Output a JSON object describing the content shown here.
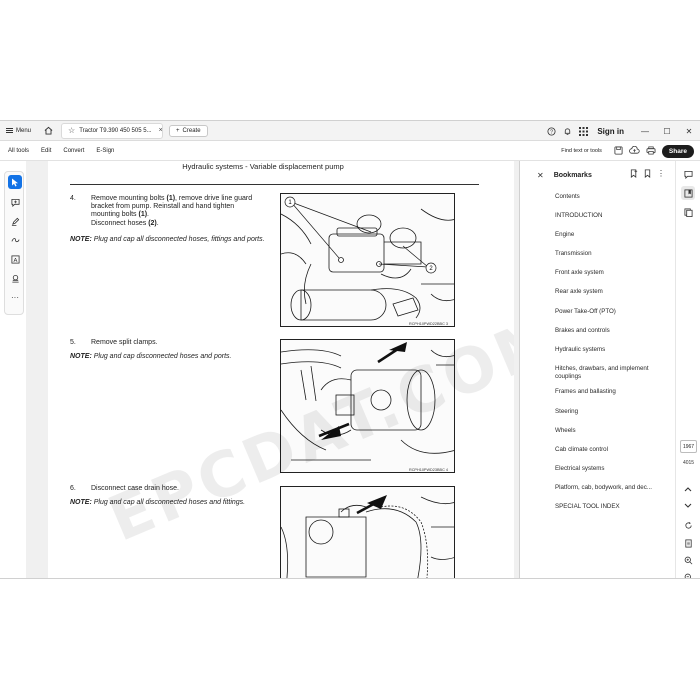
{
  "titlebar": {
    "menu_label": "Menu",
    "tab_title": "Tractor T9.390 450 505 5...",
    "create_label": "Create",
    "signin_label": "Sign in"
  },
  "toolbar": {
    "items": [
      "All tools",
      "Edit",
      "Convert",
      "E-Sign"
    ],
    "find_label": "Find text or tools",
    "share_label": "Share"
  },
  "document": {
    "header": "Hydraulic systems - Variable displacement pump",
    "watermark": "EPCDAT.COM",
    "steps": [
      {
        "num": "4.",
        "text_a": "Remove mounting bolts ",
        "bold_a": "(1)",
        "text_b": ", remove drive line guard bracket from pump.  Reinstall and hand tighten mounting bolts ",
        "bold_b": "(1)",
        "text_c": ".",
        "line2_a": "Disconnect hoses ",
        "line2_bold": "(2)",
        "line2_b": ".",
        "note_label": "NOTE:",
        "note_text": " Plug and cap all disconnected hoses, fittings and ports.",
        "fig_ref": "RCPH10PWD22BBC   3",
        "callouts": [
          "1",
          "2"
        ]
      },
      {
        "num": "5.",
        "text": "Remove split clamps.",
        "note_label": "NOTE:",
        "note_text": " Plug and cap disconnected hoses and ports.",
        "fig_ref": "RCPH10PWD23BBC   4"
      },
      {
        "num": "6.",
        "text": "Disconnect case drain hose.",
        "note_label": "NOTE:",
        "note_text": " Plug and cap all disconnected hoses and fittings."
      }
    ]
  },
  "bookmarks": {
    "title": "Bookmarks",
    "items": [
      "Contents",
      "INTRODUCTION",
      "Engine",
      "Transmission",
      "Front axle system",
      "Rear axle system",
      "Power Take-Off (PTO)",
      "Brakes and controls",
      "Hydraulic systems",
      "Hitches, drawbars, and implement couplings",
      "Frames and ballasting",
      "Steering",
      "Wheels",
      "Cab climate control",
      "Electrical systems",
      "Platform, cab, bodywork, and dec...",
      "SPECIAL TOOL INDEX"
    ]
  },
  "pager": {
    "current": "1967",
    "total": "4015"
  }
}
